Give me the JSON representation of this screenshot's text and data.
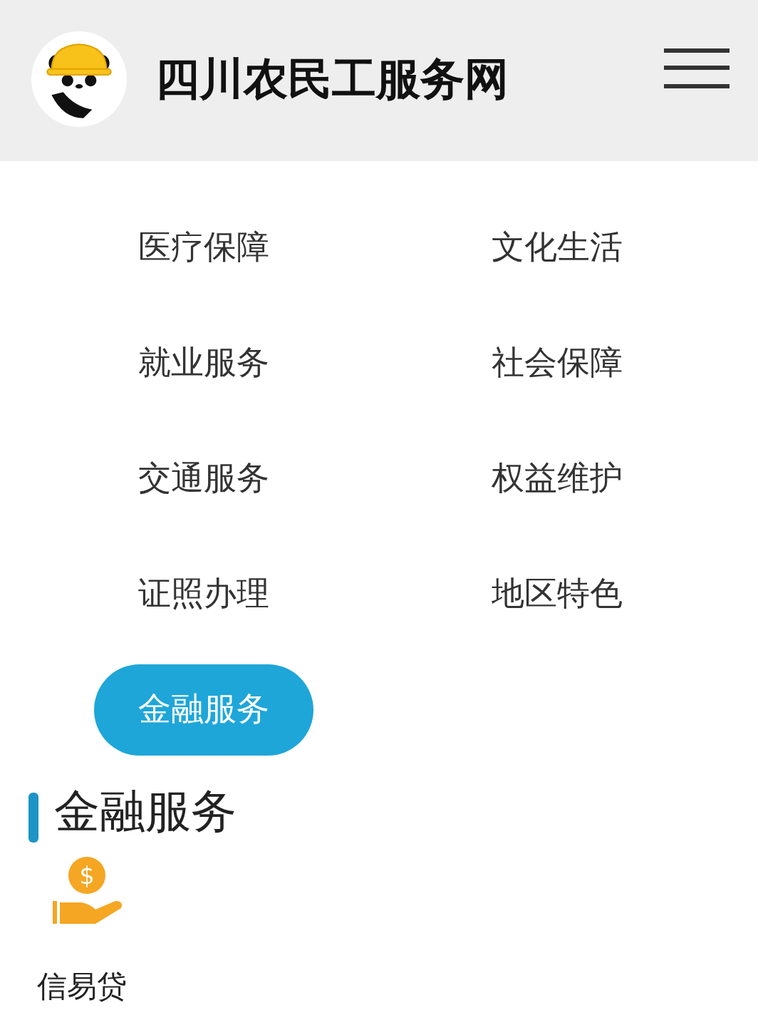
{
  "header": {
    "title": "四川农民工服务网"
  },
  "nav": [
    {
      "label": "医疗保障",
      "selected": false
    },
    {
      "label": "文化生活",
      "selected": false
    },
    {
      "label": "就业服务",
      "selected": false
    },
    {
      "label": "社会保障",
      "selected": false
    },
    {
      "label": "交通服务",
      "selected": false
    },
    {
      "label": "权益维护",
      "selected": false
    },
    {
      "label": "证照办理",
      "selected": false
    },
    {
      "label": "地区特色",
      "selected": false
    },
    {
      "label": "金融服务",
      "selected": true
    }
  ],
  "section": {
    "title": "金融服务",
    "items": [
      {
        "label": "信易贷",
        "icon_symbol": "$"
      }
    ]
  }
}
